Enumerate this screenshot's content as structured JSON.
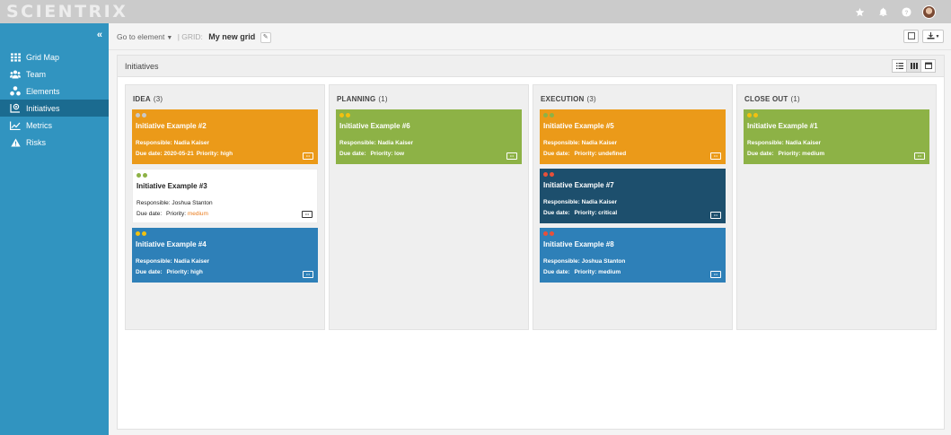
{
  "app": {
    "logo": "SCIENTRIX"
  },
  "topbar": {
    "icons": [
      "star-icon",
      "bell-icon",
      "help-icon",
      "avatar"
    ]
  },
  "sidebar": {
    "collapse": "«",
    "items": [
      {
        "label": "Grid Map",
        "icon": "grid-icon",
        "active": false
      },
      {
        "label": "Team",
        "icon": "team-icon",
        "active": false
      },
      {
        "label": "Elements",
        "icon": "elements-icon",
        "active": false
      },
      {
        "label": "Initiatives",
        "icon": "initiatives-icon",
        "active": true
      },
      {
        "label": "Metrics",
        "icon": "chart-icon",
        "active": false
      },
      {
        "label": "Risks",
        "icon": "warning-icon",
        "active": false
      }
    ]
  },
  "subbar": {
    "goto_label": "Go to element",
    "grid_label": "| GRID:",
    "grid_name": "My new grid"
  },
  "panel": {
    "title": "Initiatives"
  },
  "colors": {
    "sidebar": "#3194c0",
    "sidebar_active": "#1b6b90",
    "orange": "#eb9a19",
    "green": "#8db246",
    "blue": "#2e80b8",
    "navy": "#1d4f6d",
    "dot_grey": "#c9c9c9",
    "dot_green": "#8db246",
    "dot_yellow": "#f2c10f",
    "dot_red": "#e8503a"
  },
  "labels": {
    "responsible": "Responsible:",
    "due": "Due date:",
    "priority": "Priority:"
  },
  "columns": [
    {
      "title": "IDEA",
      "count": "(3)",
      "cards": [
        {
          "title": "Initiative Example #2",
          "responsible": "Nadia Kaiser",
          "due": "2020-05-21",
          "priority": "high",
          "style": "orange",
          "dots": [
            "dot_grey",
            "dot_grey"
          ]
        },
        {
          "title": "Initiative Example #3",
          "responsible": "Joshua Stanton",
          "due": "",
          "priority": "medium",
          "style": "white",
          "dots": [
            "dot_green",
            "dot_green"
          ]
        },
        {
          "title": "Initiative Example #4",
          "responsible": "Nadia Kaiser",
          "due": "",
          "priority": "high",
          "style": "blue",
          "dots": [
            "dot_yellow",
            "dot_yellow"
          ]
        }
      ]
    },
    {
      "title": "PLANNING",
      "count": "(1)",
      "cards": [
        {
          "title": "Initiative Example #6",
          "responsible": "Nadia Kaiser",
          "due": "",
          "priority": "low",
          "style": "green",
          "dots": [
            "dot_yellow",
            "dot_yellow"
          ]
        }
      ]
    },
    {
      "title": "EXECUTION",
      "count": "(3)",
      "cards": [
        {
          "title": "Initiative Example #5",
          "responsible": "Nadia Kaiser",
          "due": "",
          "priority": "undefined",
          "style": "orange",
          "dots": [
            "dot_green",
            "dot_green"
          ]
        },
        {
          "title": "Initiative Example #7",
          "responsible": "Nadia Kaiser",
          "due": "",
          "priority": "critical",
          "style": "navy",
          "dots": [
            "dot_red",
            "dot_red"
          ]
        },
        {
          "title": "Initiative Example #8",
          "responsible": "Joshua Stanton",
          "due": "",
          "priority": "medium",
          "style": "blue",
          "dots": [
            "dot_red",
            "dot_red"
          ]
        }
      ]
    },
    {
      "title": "CLOSE OUT",
      "count": "(1)",
      "cards": [
        {
          "title": "Initiative Example #1",
          "responsible": "Nadia Kaiser",
          "due": "",
          "priority": "medium",
          "style": "green",
          "dots": [
            "dot_yellow",
            "dot_yellow"
          ]
        }
      ]
    }
  ]
}
